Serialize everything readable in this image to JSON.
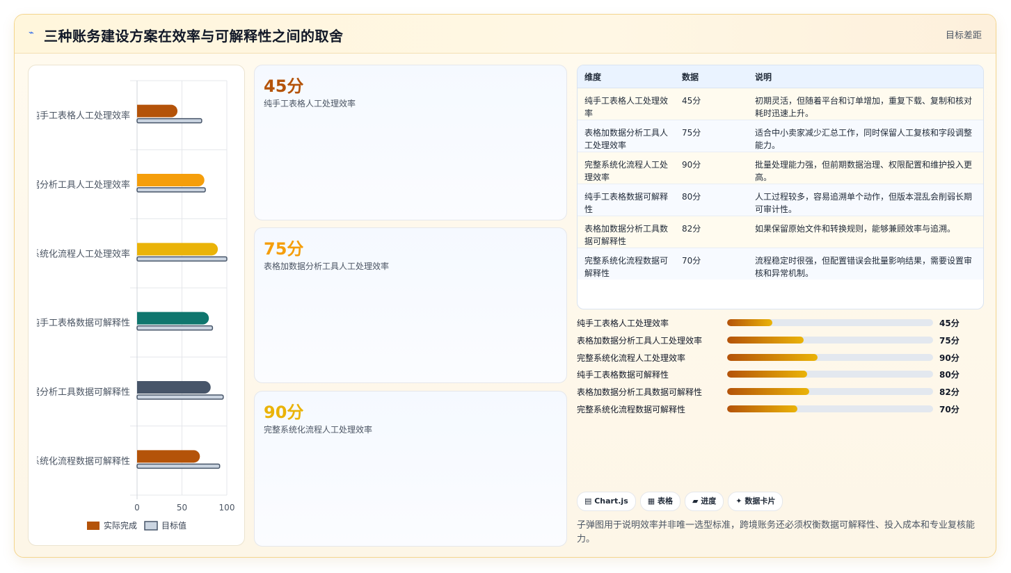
{
  "header": {
    "icon": "flash-icon",
    "title": "三种账务建设方案在效率与可解释性之间的取舍",
    "right_label": "目标差距"
  },
  "stat_cards": [
    {
      "value": "45分",
      "label": "纯手工表格人工处理效率",
      "color": "#b45309"
    },
    {
      "value": "75分",
      "label": "表格加数据分析工具人工处理效率",
      "color": "#f59e0b"
    },
    {
      "value": "90分",
      "label": "完整系统化流程人工处理效率",
      "color": "#eab308"
    }
  ],
  "table": {
    "headers": [
      "维度",
      "数据",
      "说明"
    ],
    "rows": [
      {
        "dim": "纯手工表格人工处理效率",
        "value": "45分",
        "desc": "初期灵活，但随着平台和订单增加，重复下载、复制和核对耗时迅速上升。"
      },
      {
        "dim": "表格加数据分析工具人工处理效率",
        "value": "75分",
        "desc": "适合中小卖家减少汇总工作，同时保留人工复核和字段调整能力。"
      },
      {
        "dim": "完整系统化流程人工处理效率",
        "value": "90分",
        "desc": "批量处理能力强，但前期数据治理、权限配置和维护投入更高。"
      },
      {
        "dim": "纯手工表格数据可解释性",
        "value": "80分",
        "desc": "人工过程较多，容易追溯单个动作，但版本混乱会削弱长期可审计性。"
      },
      {
        "dim": "表格加数据分析工具数据可解释性",
        "value": "82分",
        "desc": "如果保留原始文件和转换规则，能够兼顾效率与追溯。"
      },
      {
        "dim": "完整系统化流程数据可解释性",
        "value": "70分",
        "desc": "流程稳定时很强，但配置错误会批量影响结果，需要设置审核和异常机制。"
      }
    ]
  },
  "progress": [
    {
      "label": "纯手工表格人工处理效率",
      "value_text": "45分",
      "fraction": 0.22
    },
    {
      "label": "表格加数据分析工具人工处理效率",
      "value_text": "75分",
      "fraction": 0.37
    },
    {
      "label": "完整系统化流程人工处理效率",
      "value_text": "90分",
      "fraction": 0.44
    },
    {
      "label": "纯手工表格数据可解释性",
      "value_text": "80分",
      "fraction": 0.39
    },
    {
      "label": "表格加数据分析工具数据可解释性",
      "value_text": "82分",
      "fraction": 0.4
    },
    {
      "label": "完整系统化流程数据可解释性",
      "value_text": "70分",
      "fraction": 0.34
    }
  ],
  "tags": [
    {
      "icon": "chart-icon",
      "glyph": "▤",
      "label": "Chart.js"
    },
    {
      "icon": "table-icon",
      "glyph": "▦",
      "label": "表格"
    },
    {
      "icon": "progress-icon",
      "glyph": "▰",
      "label": "进度"
    },
    {
      "icon": "sparkle-icon",
      "glyph": "✦",
      "label": "数据卡片"
    }
  ],
  "footnote": "子弹图用于说明效率并非唯一选型标准，跨境账务还必须权衡数据可解释性、投入成本和专业复核能力。",
  "chart_data": {
    "type": "bar",
    "orientation": "horizontal",
    "categories": [
      "纯手工表格人工处理效率",
      "表格加数据分析工具人工处理效率",
      "完整系统化流程人工处理效率",
      "纯手工表格数据可解释性",
      "表格加数据分析工具数据可解释性",
      "完整系统化流程数据可解释性"
    ],
    "series": [
      {
        "name": "实际完成",
        "values": [
          45,
          75,
          90,
          80,
          82,
          70
        ],
        "colors": [
          "#b45309",
          "#f59e0b",
          "#eab308",
          "#0f766e",
          "#475569",
          "#b45309"
        ]
      },
      {
        "name": "目标值",
        "values": [
          72,
          76,
          100,
          84,
          96,
          92
        ],
        "color": "#cbd5e1",
        "stroke": "#475569"
      }
    ],
    "xlim": [
      0,
      100
    ],
    "xticks": [
      0,
      50,
      100
    ],
    "legend_position": "bottom",
    "grid": true
  }
}
